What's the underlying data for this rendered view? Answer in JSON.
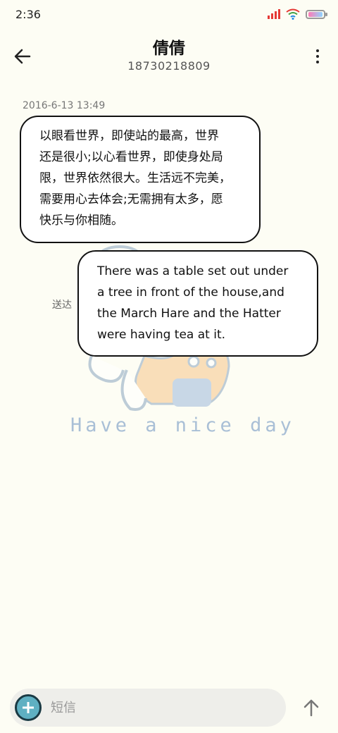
{
  "status_bar": {
    "time": "2:36",
    "icons": [
      "signal-icon",
      "wifi-icon",
      "battery-icon"
    ]
  },
  "header": {
    "back_icon": "arrow-left-icon",
    "contact_name": "倩倩",
    "contact_phone": "18730218809",
    "menu_icon": "more-vertical-icon"
  },
  "conversation": {
    "timestamp": "2016-6-13 13:49",
    "messages": [
      {
        "direction": "incoming",
        "lines": [
          "以眼看世界，即使站的最高，世界",
          "还是很小;以心看世界，即使身处局",
          "限，世界依然很大。生活远不完美，",
          "需要用心去体会;无需拥有太多，愿",
          "快乐与你相随。"
        ]
      },
      {
        "direction": "outgoing",
        "lines": [
          "There was a table set out under",
          "a tree in front of the house,and",
          "the March Hare and the Hatter",
          "were having tea at it."
        ],
        "status": "送达"
      }
    ]
  },
  "wallpaper": {
    "text": "Have a nice day"
  },
  "input_bar": {
    "add_icon": "plus-icon",
    "placeholder": "短信",
    "value": "",
    "send_icon": "arrow-up-icon"
  },
  "colors": {
    "background": "#fdfdf4",
    "bubble_border": "#111111",
    "add_button": "#5fb0c2",
    "wallpaper_text": "#a9bfd6",
    "signal": "#e53935"
  }
}
